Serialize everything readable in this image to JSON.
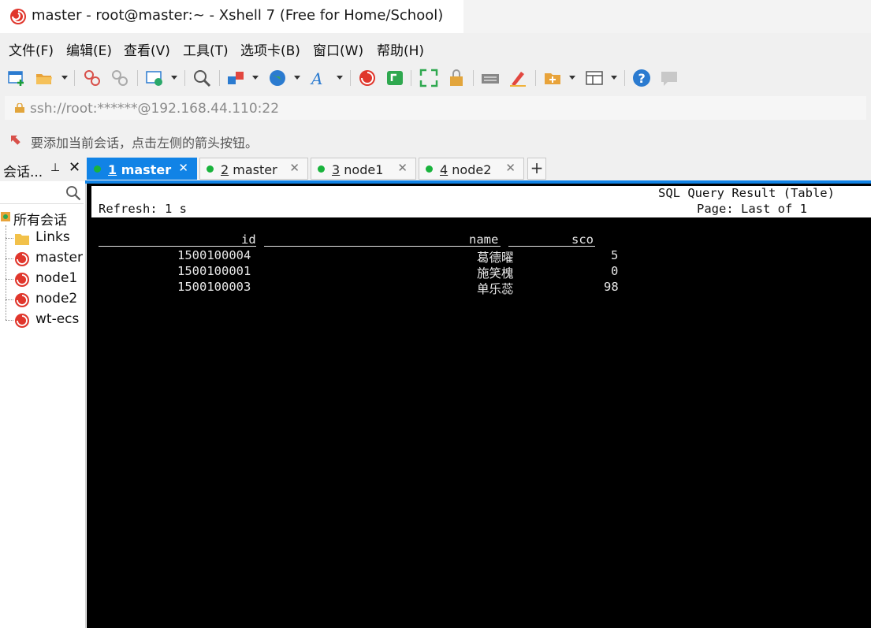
{
  "window": {
    "title": "master - root@master:~ - Xshell 7 (Free for Home/School)"
  },
  "menu": [
    "文件(F)",
    "编辑(E)",
    "查看(V)",
    "工具(T)",
    "选项卡(B)",
    "窗口(W)",
    "帮助(H)"
  ],
  "address": {
    "value": "ssh://root:******@192.168.44.110:22"
  },
  "hint": "要添加当前会话，点击左侧的箭头按钮。",
  "sidebar": {
    "title": "会话...",
    "pin": "⊥",
    "close": "✕",
    "root": "所有会话",
    "items": [
      "Links",
      "master",
      "node1",
      "node2",
      "wt-ecs"
    ]
  },
  "tabs": [
    {
      "num": "1",
      "name": " master",
      "active": true
    },
    {
      "num": "2",
      "name": " master",
      "active": false
    },
    {
      "num": "3",
      "name": " node1",
      "active": false
    },
    {
      "num": "4",
      "name": " node2",
      "active": false
    }
  ],
  "tab_close": "✕",
  "tab_add": "+",
  "terminal": {
    "header_right_1": "SQL Query Result (Table)",
    "header_right_2": "Page: Last of 1",
    "header_left": "Refresh: 1 s",
    "columns": [
      "id",
      "name",
      "sco"
    ],
    "rows": [
      {
        "id": "1500100004",
        "name": "葛德曜",
        "sco": "5"
      },
      {
        "id": "1500100001",
        "name": "施笑槐",
        "sco": "0"
      },
      {
        "id": "1500100003",
        "name": "单乐蕊",
        "sco": "98"
      }
    ]
  },
  "colors": {
    "accent": "#1183e6",
    "session_dot": "#19b33c",
    "terminal_bg": "#000000"
  },
  "icons": [
    "xshell-logo-icon",
    "lock-icon",
    "arrow-icon",
    "search-icon",
    "folder-icon",
    "session-icon"
  ]
}
